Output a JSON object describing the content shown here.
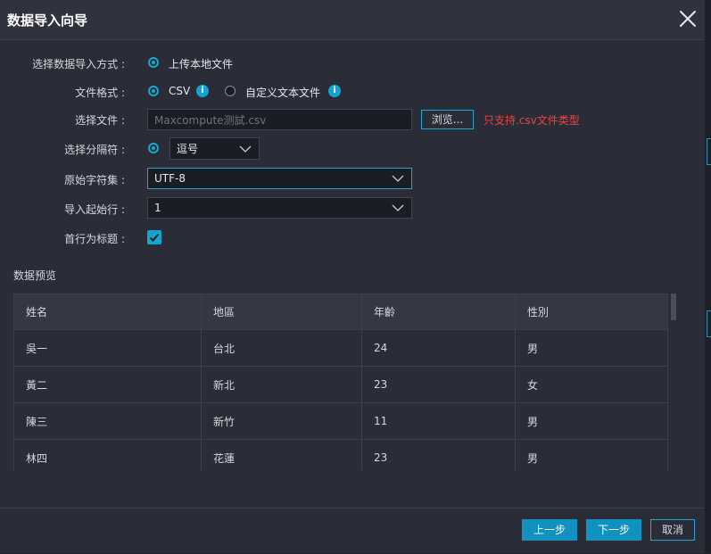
{
  "dialog": {
    "title": "数据导入向导",
    "close_icon": "close-icon"
  },
  "form": {
    "import_method": {
      "label": "选择数据导入方式 :",
      "option": "上传本地文件",
      "selected": true
    },
    "file_format": {
      "label": "文件格式 :",
      "options": [
        {
          "label": "CSV",
          "selected": true
        },
        {
          "label": "自定义文本文件",
          "selected": false
        }
      ],
      "info_icon": "info-icon"
    },
    "file": {
      "label": "选择文件 :",
      "placeholder": "Maxcompute测試.csv",
      "browse_label": "浏览...",
      "warning": "只支持.csv文件类型"
    },
    "delimiter": {
      "label": "选择分隔符 :",
      "value": "逗号"
    },
    "charset": {
      "label": "原始字符集 :",
      "value": "UTF-8"
    },
    "start_row": {
      "label": "导入起始行 :",
      "value": "1"
    },
    "header_row": {
      "label": "首行为标题 :",
      "checked": true
    }
  },
  "preview": {
    "title": "数据预览",
    "columns": [
      "姓名",
      "地區",
      "年齡",
      "性別"
    ],
    "rows": [
      [
        "吳一",
        "台北",
        "24",
        "男"
      ],
      [
        "黃二",
        "新北",
        "23",
        "女"
      ],
      [
        "陳三",
        "新竹",
        "11",
        "男"
      ],
      [
        "林四",
        "花蓮",
        "23",
        "男"
      ]
    ]
  },
  "footer": {
    "prev_label": "上一步",
    "next_label": "下一步",
    "cancel_label": "取消"
  },
  "colors": {
    "accent": "#14a7d0",
    "primary_button": "#1191be",
    "warning": "#f0413c",
    "background": "#2a2d38"
  }
}
